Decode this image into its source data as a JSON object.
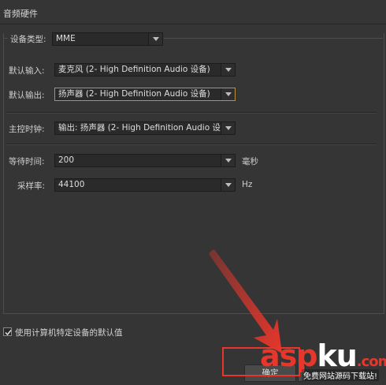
{
  "panel": {
    "title": "音频硬件",
    "group_legend": "设备类型:"
  },
  "device_type": {
    "value": "MME"
  },
  "default_input": {
    "label": "默认输入:",
    "value": "麦克风 (2- High Definition Audio 设备)"
  },
  "default_output": {
    "label": "默认输出:",
    "value": "扬声器 (2- High Definition Audio 设备)"
  },
  "master_clock": {
    "label": "主控时钟:",
    "value": "输出: 扬声器 (2- High Definition Audio 设..."
  },
  "latency": {
    "label": "等待时间:",
    "value": "200",
    "unit": "毫秒"
  },
  "sample_rate": {
    "label": "采样率:",
    "value": "44100",
    "unit": "Hz"
  },
  "use_defaults": {
    "label": "使用计算机特定设备的默认值",
    "checked": true
  },
  "buttons": {
    "ok_label": "确定"
  },
  "watermark": {
    "text_a": "asp",
    "text_b": "ku",
    "text_c": ".com",
    "sub": "免费网站源码下载站!"
  },
  "colors": {
    "background": "#353535",
    "field": "#2a2a2a",
    "focus_border": "#b7923f",
    "annotation": "#e8362b"
  }
}
